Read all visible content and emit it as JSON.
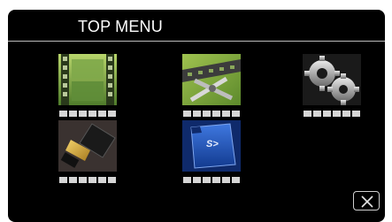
{
  "header": {
    "title": "TOP MENU"
  },
  "tiles": [
    {
      "name": "video-icon",
      "dots": 6
    },
    {
      "name": "edit-clip-icon",
      "dots": 6
    },
    {
      "name": "settings-gear-icon",
      "dots": 6
    },
    {
      "name": "hdmi-icon",
      "dots": 6
    },
    {
      "name": "sd-card-icon",
      "dots": 6
    }
  ],
  "close": {
    "icon": "close-icon"
  },
  "colors": {
    "background": "#000000",
    "label_placeholder": "#d6d6d6",
    "sd_card": "#1e4fb5"
  }
}
